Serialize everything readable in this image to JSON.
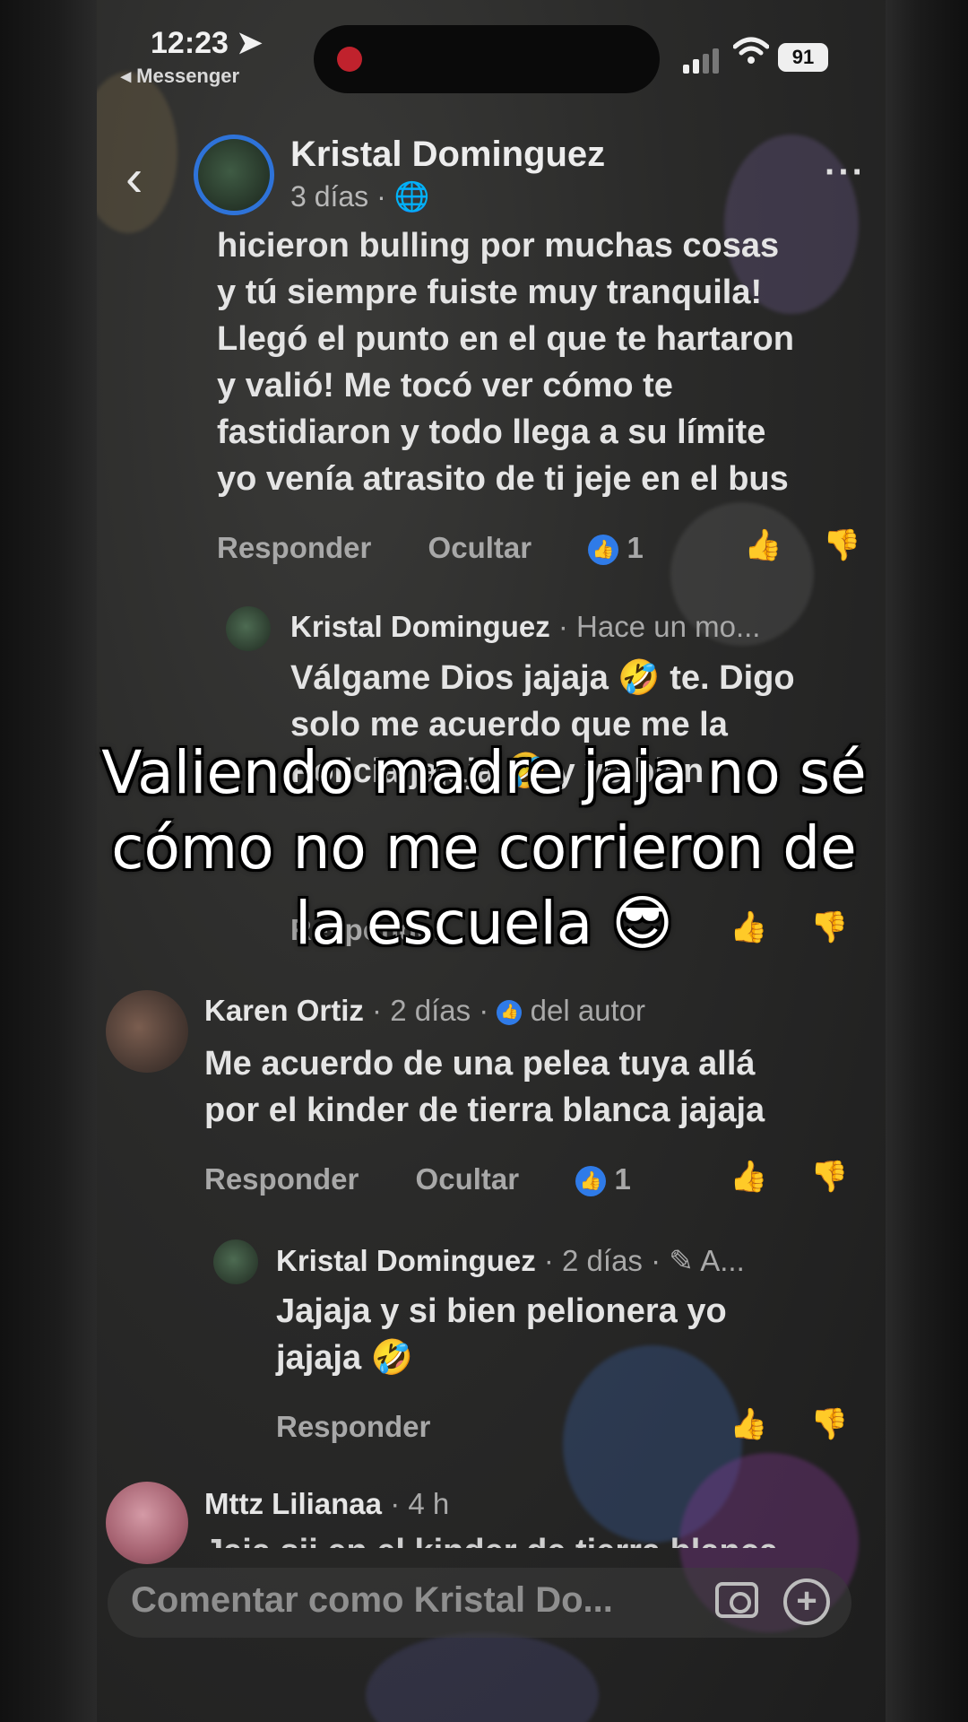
{
  "status_bar": {
    "time": "12:23",
    "back_app": "◂ Messenger",
    "battery": "91"
  },
  "header": {
    "name": "Kristal Dominguez",
    "meta": "3 días · 🌐",
    "back_glyph": "‹",
    "more_glyph": "···"
  },
  "comment_main": {
    "lines": [
      "hicieron bulling por muchas cosas",
      "y tú siempre fuiste muy tranquila!",
      "Llegó el punto en el que te hartaron",
      "y valió! Me tocó ver cómo te",
      "fastidiaron y todo llega a su límite",
      "yo venía atrasito de ti jeje en el bus"
    ],
    "reply": "Responder",
    "hide": "Ocultar",
    "likes": "1"
  },
  "reply_1": {
    "name": "Kristal Dominguez",
    "meta": " · Hace un mo...",
    "lines": [
      "Válgame Dios jajaja 🤣 te. Digo",
      "solo me acuerdo que me la",
      "Policia jajaja 🤣 y yo bien"
    ],
    "action": "Responder"
  },
  "comment_karen": {
    "name": "Karen Ortiz",
    "meta": " · 2 días · ",
    "badge": "del autor",
    "lines": [
      "Me acuerdo de una pelea tuya allá",
      "por el kinder de tierra blanca jajaja"
    ],
    "reply": "Responder",
    "hide": "Ocultar",
    "likes": "1"
  },
  "reply_2": {
    "name": "Kristal Dominguez",
    "meta": " · 2 días · ✎ A...",
    "lines": [
      "Jajaja y si bien pelionera yo",
      "jajaja 🤣"
    ],
    "action": "Responder"
  },
  "comment_mttz": {
    "name": "Mttz Lilianaa",
    "meta": " · 4 h",
    "partial": "Jaja sii en el kinder de tierra blanca"
  },
  "input": {
    "placeholder": "Comentar como Kristal Do..."
  },
  "caption": {
    "lines": [
      "Valiendo madre jaja no sé",
      "cómo no me corrieron de",
      "la escuela 😎"
    ]
  },
  "icons": [
    "location-arrow-icon",
    "signal-icon",
    "wifi-icon",
    "battery-icon",
    "globe-icon",
    "like-icon",
    "dislike-icon",
    "camera-icon",
    "plus-icon",
    "edit-icon"
  ],
  "colors": {
    "accent": "#2f7be8",
    "recording": "#c0222d"
  }
}
